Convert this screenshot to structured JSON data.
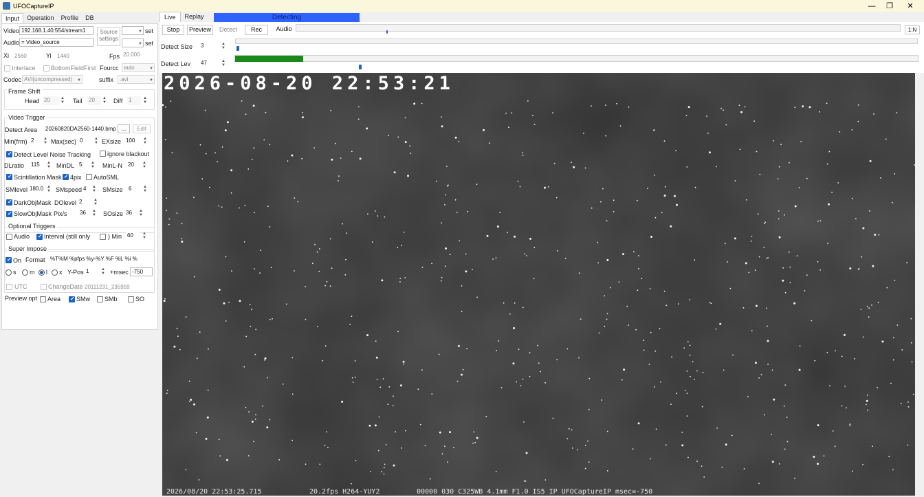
{
  "window": {
    "title": "UFOCaptureIP"
  },
  "left_tabs": [
    "Input",
    "Operation",
    "Profile",
    "DB"
  ],
  "input": {
    "video_label": "Video",
    "video_value": "192.168.1.40:554/stream1",
    "audio_label": "Audio",
    "audio_value": "= Video_source",
    "source_settings": "Source settings",
    "set_label": "set",
    "xi_label": "Xi",
    "xi_value": "2560",
    "yi_label": "Yi",
    "yi_value": "1440",
    "fps_label": "Fps",
    "fps_value": "20.000",
    "interlace": "Interlace",
    "bottom_field_first": "BottomFieldFirst",
    "fourcc_label": "Fourcc",
    "fourcc_value": "auto",
    "codec_label": "Codec",
    "codec_value": "AVI(uncompressed)",
    "suffix_label": "suffix",
    "suffix_value": ".avi"
  },
  "frame_shift": {
    "title": "Frame Shift",
    "head_label": "Head",
    "head_value": "20",
    "tail_label": "Tail",
    "tail_value": "20",
    "diff_label": "Diff",
    "diff_value": "1"
  },
  "video_trigger": {
    "title": "Video Trigger",
    "detect_area_label": "Detect Area",
    "detect_area_value": "20260820DA2560-1440.bmp",
    "browse_label": "...",
    "edit_label": "Edit",
    "min_frm_label": "Min(frm)",
    "min_frm_value": "2",
    "max_sec_label": "Max(sec)",
    "max_sec_value": "0",
    "exsize_label": "EXsize",
    "exsize_value": "100",
    "noise_tracking": "Detect Level Noise Tracking",
    "ignore_blackout": "ignore blackout",
    "dlratio_label": "DLratio",
    "dlratio_value": "115",
    "mindl_label": "MinDL",
    "mindl_value": "5",
    "minln_label": "MinL-N",
    "minln_value": "20",
    "scintillation_mask": "Scintillation Mask",
    "four_pix": "4pix",
    "autosml": "AutoSML",
    "smlevel_label": "SMlevel",
    "smlevel_value": "180.0",
    "smspeed_label": "SMspeed",
    "smspeed_value": "4",
    "smsize_label": "SMsize",
    "smsize_value": "6",
    "darkobj_mask": "DarkObjMask",
    "dolevel_label": "DOlevel",
    "dolevel_value": "2",
    "slowobj_mask": "SlowObjMask",
    "pixs_label": "Pix/s",
    "pixs_value": "36",
    "sosize_label": "SOsize",
    "sosize_value": "36"
  },
  "optional_triggers": {
    "title": "Optional Triggers",
    "audio": "Audio",
    "interval": "Interval (still only",
    "min_label": ") Min",
    "min_value": "60"
  },
  "super_impose": {
    "title": "Super Impose",
    "on_label": "On",
    "format_label": "Format",
    "format_value": "%T%M         %pfps %y-%Y %F %L  %i %",
    "radio_s": "s",
    "radio_m": "m",
    "radio_l": "l",
    "radio_x": "x",
    "ypos_label": "Y-Pos",
    "ypos_value": "1",
    "msec_label": "+msec",
    "msec_value": "-750",
    "utc": "UTC",
    "change_date": "ChangeDate",
    "change_date_value": "20111231_235959",
    "preview_opt": "Preview opt",
    "area": "Area",
    "smw": "SMw",
    "smb": "SMb",
    "so": "SO"
  },
  "right_tabs": [
    "Live",
    "Replay"
  ],
  "status": "Detecting",
  "toolbar": {
    "stop": "Stop",
    "preview": "Preview",
    "detect": "Detect",
    "rec": "Rec",
    "audio": "Audio",
    "ratio": "1:N"
  },
  "detect_size": {
    "label": "Detect Size",
    "value": "3"
  },
  "detect_lev": {
    "label": "Detect Lev",
    "value": "47",
    "level_fraction": 0.1
  },
  "video": {
    "timestamp": "2026-08-20  22:53:21",
    "footer_datetime": "2026/08/20 22:53:25.715",
    "footer_fps": "20.2fps H264-YUY2",
    "footer_info": "00000 030  C325WB 4.1mm F1.0 IS5 IP UFOCaptureIP  msec=-750"
  },
  "colors": {
    "accent": "#1a63c4",
    "detecting_bg": "#2f63ff",
    "level_bar": "#1a8a1a",
    "video_bg": "#2c2c2c"
  }
}
